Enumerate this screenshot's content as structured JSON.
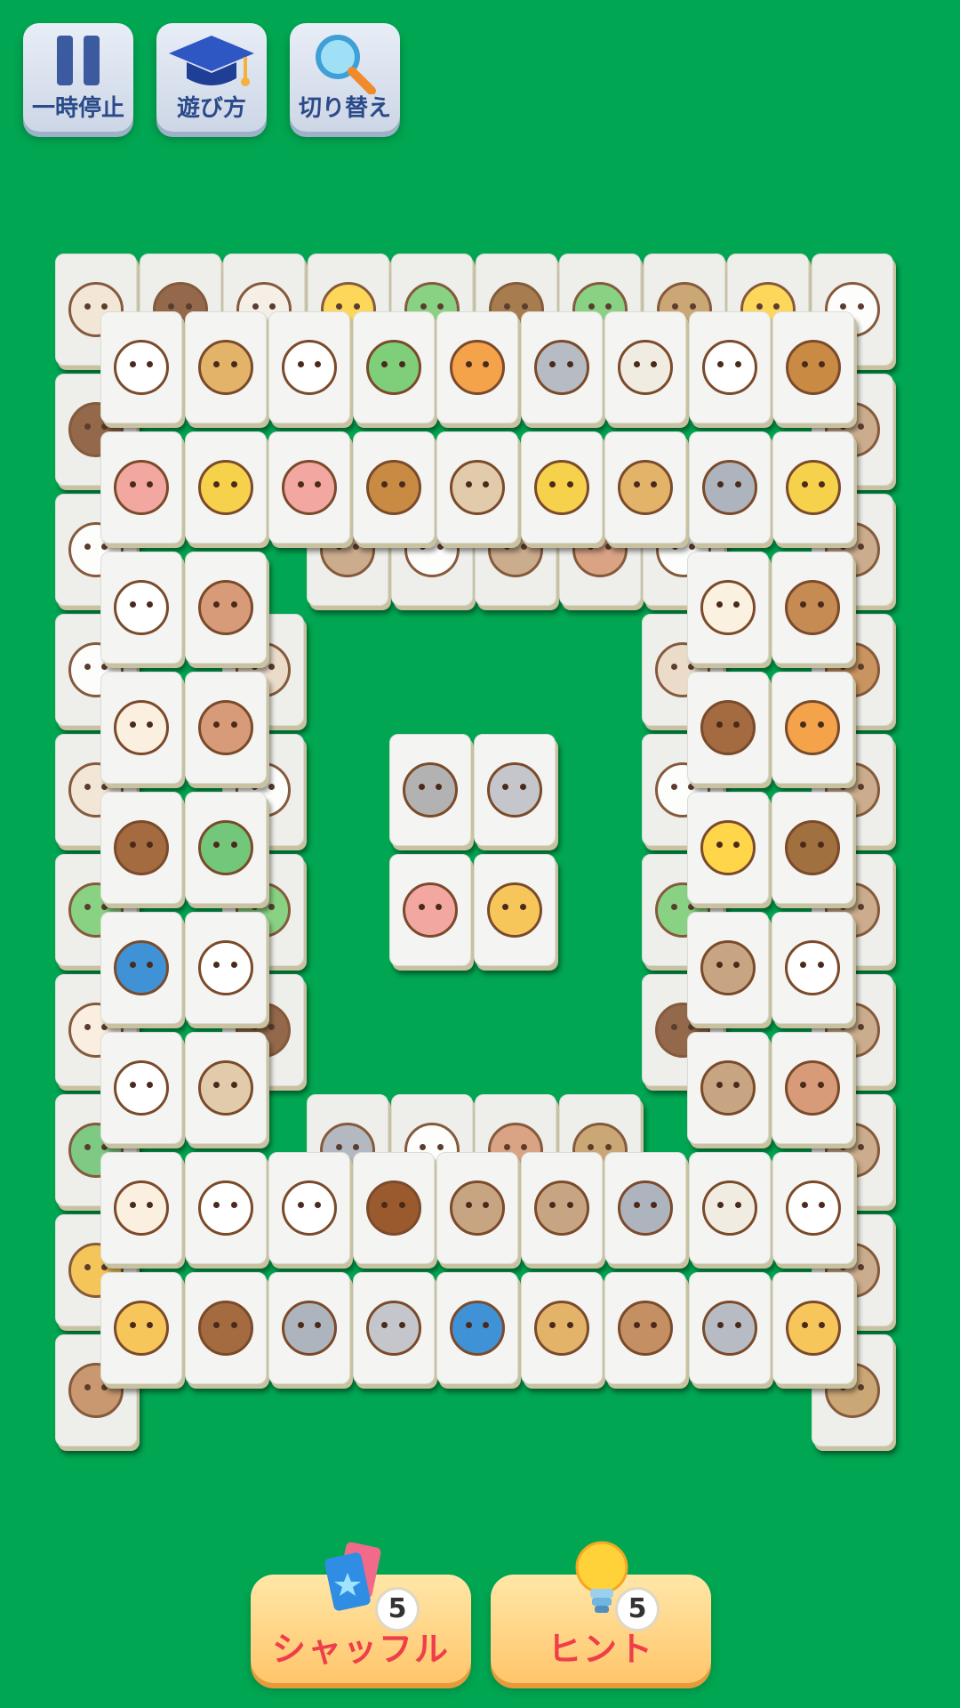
{
  "toolbar": {
    "pause_label": "一時停止",
    "howto_label": "遊び方",
    "switch_label": "切り替え"
  },
  "actions": {
    "shuffle_label": "シャッフル",
    "shuffle_count": "5",
    "hint_label": "ヒント",
    "hint_count": "5"
  },
  "colors": {
    "background": "#00a651",
    "tile": "#f4f4f2",
    "action_text": "#ef3e4a"
  },
  "board": {
    "bottom_layer": [
      [
        "bird-red",
        "hedgehog",
        "bird",
        "chick",
        "frog",
        "gorilla",
        "frog",
        "deer",
        "chick",
        "penguin"
      ],
      [
        "hedgehog",
        "",
        "",
        "",
        "",
        "",
        "",
        "",
        "",
        "bear"
      ],
      [
        "penguin",
        "",
        "",
        "",
        "",
        "",
        "",
        "",
        "",
        "bear"
      ],
      [
        "goat",
        "",
        "",
        "",
        "",
        "",
        "",
        "",
        "",
        "squirrel"
      ],
      [
        "bird-red",
        "",
        "",
        "",
        "",
        "",
        "",
        "",
        "",
        "bear"
      ],
      [
        "frog",
        "",
        "",
        "",
        "",
        "",
        "",
        "",
        "",
        "bear"
      ],
      [
        "rabbit",
        "",
        "",
        "",
        "",
        "",
        "",
        "",
        "",
        "bear"
      ],
      [
        "snake",
        "",
        "",
        "",
        "",
        "",
        "",
        "",
        "",
        "bear"
      ],
      [
        "tiger",
        "",
        "",
        "",
        "",
        "",
        "",
        "",
        "",
        "bear"
      ],
      [
        "sparrow",
        "",
        "",
        "",
        "",
        "",
        "",
        "",
        "",
        "deer"
      ]
    ],
    "middle_ring_top": [
      "bear",
      "sheep",
      "bear",
      "hippo",
      "sheep"
    ],
    "middle_ring_bottom": [
      "koala",
      "panda",
      "hippo",
      "deer"
    ],
    "middle_ring_left": [
      "cat",
      "sheep",
      "frog",
      "hedgehog"
    ],
    "middle_ring_right": [
      "cat",
      "sheep",
      "frog",
      "hedgehog"
    ],
    "top_rows": [
      [
        "sheep",
        "monkey",
        "cow",
        "frog",
        "cat-orange",
        "wolf",
        "seal",
        "panda",
        "beaver"
      ],
      [
        "flamingo",
        "parakeet",
        "flamingo",
        "beaver",
        "cat-tabby",
        "parakeet",
        "monkey",
        "koala",
        "parakeet"
      ]
    ],
    "left_cols": [
      [
        "panda",
        "hippo"
      ],
      [
        "rabbit",
        "hippo"
      ],
      [
        "otter",
        "snake"
      ],
      [
        "peacock",
        "sheep"
      ],
      [
        "sheep",
        "cat-tabby"
      ]
    ],
    "right_cols": [
      [
        "rat",
        "squirrel"
      ],
      [
        "otter",
        "cat-orange"
      ],
      [
        "chick",
        "gorilla"
      ],
      [
        "bear",
        "cow"
      ],
      [
        "bear",
        "hippo"
      ]
    ],
    "bottom_rows": [
      [
        "rabbit",
        "sheep",
        "polar-bear",
        "mandrill",
        "bear",
        "bear",
        "koala",
        "seal",
        "penguin"
      ],
      [
        "giraffe",
        "otter",
        "koala",
        "rhino",
        "peacock",
        "monkey",
        "sparrow",
        "wolf",
        "giraffe"
      ]
    ],
    "center": [
      [
        "raccoon",
        "rhino"
      ],
      [
        "flamingo",
        "giraffe"
      ]
    ]
  }
}
